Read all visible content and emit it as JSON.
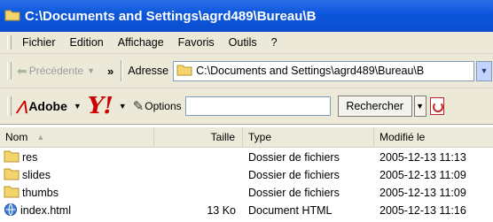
{
  "window": {
    "title": "C:\\Documents and Settings\\agrd489\\Bureau\\B"
  },
  "menu": {
    "items": [
      "Fichier",
      "Edition",
      "Affichage",
      "Favoris",
      "Outils",
      "?"
    ]
  },
  "toolbar": {
    "back_label": "Précédente",
    "chevron": "»"
  },
  "address": {
    "label": "Adresse",
    "value": "C:\\Documents and Settings\\agrd489\\Bureau\\B"
  },
  "yahoo_toolbar": {
    "adobe_label": "Adobe",
    "options_label": "Options",
    "search_value": "",
    "search_button": "Rechercher"
  },
  "columns": {
    "name": "Nom",
    "size": "Taille",
    "type": "Type",
    "modified": "Modifié le"
  },
  "files": [
    {
      "name": "res",
      "size": "",
      "type": "Dossier de fichiers",
      "modified": "2005-12-13 11:13",
      "icon": "folder-icon"
    },
    {
      "name": "slides",
      "size": "",
      "type": "Dossier de fichiers",
      "modified": "2005-12-13 11:09",
      "icon": "folder-icon"
    },
    {
      "name": "thumbs",
      "size": "",
      "type": "Dossier de fichiers",
      "modified": "2005-12-13 11:09",
      "icon": "folder-icon"
    },
    {
      "name": "index.html",
      "size": "13 Ko",
      "type": "Document HTML",
      "modified": "2005-12-13 11:16",
      "icon": "html-file-icon"
    }
  ],
  "colors": {
    "titlebar": "#0c56dc",
    "chrome": "#ece9d8",
    "folder": "#f4d46c"
  }
}
